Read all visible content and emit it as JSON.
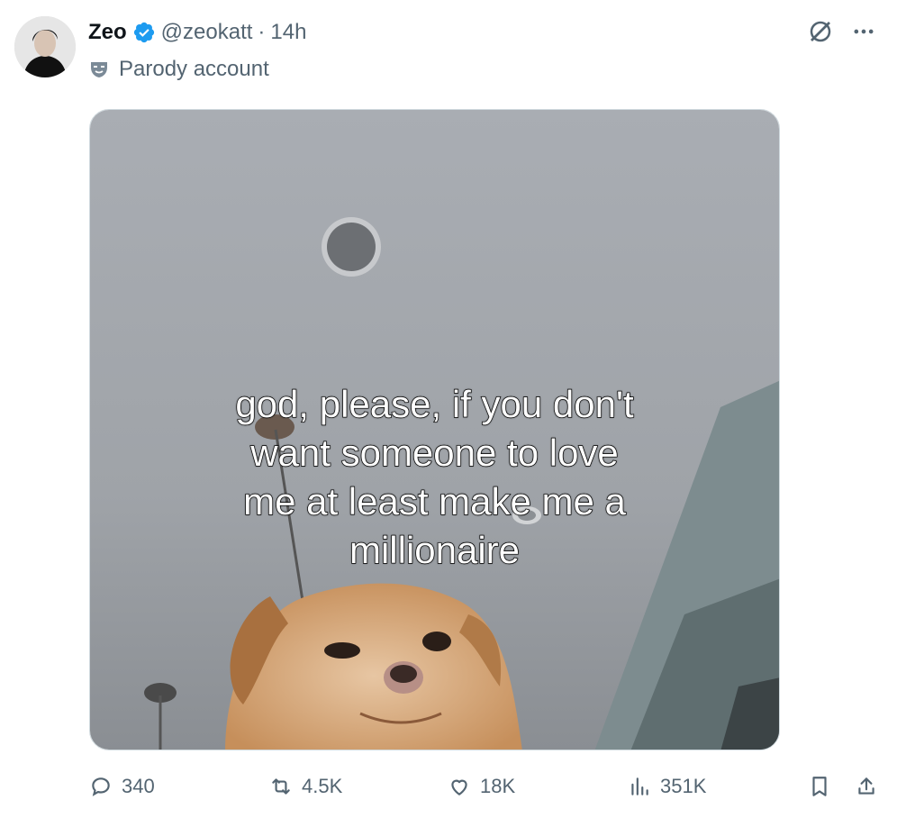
{
  "post": {
    "author": {
      "name": "Zeo",
      "handle": "@zeokatt",
      "separator": "·",
      "time": "14h",
      "label": "Parody account",
      "verified": true
    },
    "media": {
      "caption": "god, please, if you don't want someone to love me at least make me a millionaire"
    },
    "stats": {
      "replies": "340",
      "reposts": "4.5K",
      "likes": "18K",
      "views": "351K"
    }
  },
  "colors": {
    "accent": "#1d9bf0",
    "muted": "#536471",
    "text": "#0f1419"
  },
  "icons": {
    "verified": "verified-badge-icon",
    "parody": "parody-mask-icon",
    "grok": "grok-icon",
    "more": "more-icon",
    "reply": "reply-icon",
    "repost": "repost-icon",
    "like": "heart-icon",
    "views": "views-icon",
    "bookmark": "bookmark-icon",
    "share": "share-icon"
  }
}
